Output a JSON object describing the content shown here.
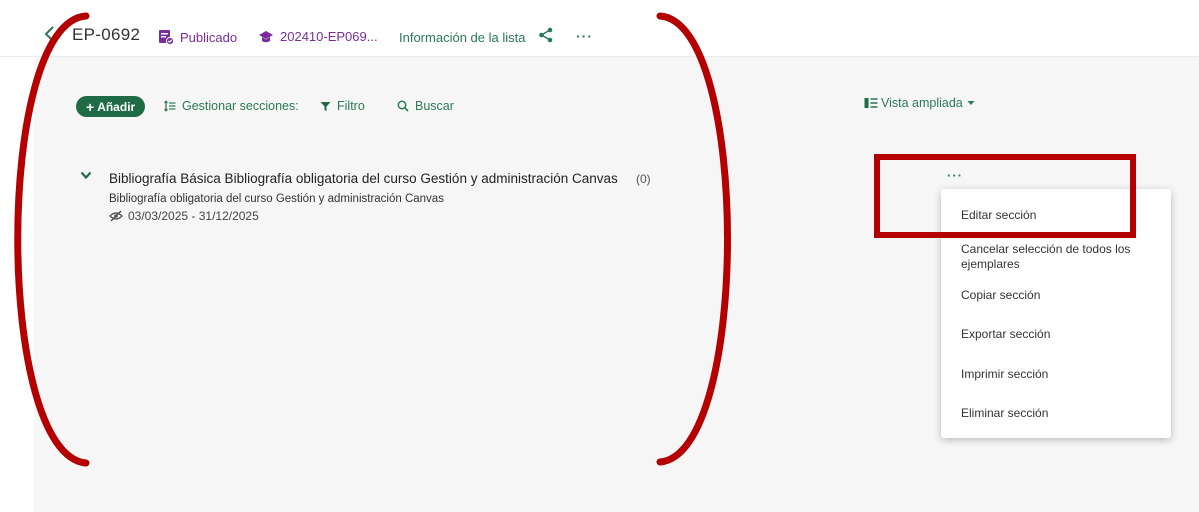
{
  "header": {
    "list_id": "EP-0692",
    "status_label": "Publicado",
    "course_label": "202410-EP069...",
    "info_link": "Información de la lista"
  },
  "toolbar": {
    "add_label": "Añadir",
    "manage_label": "Gestionar secciones:",
    "filter_label": "Filtro",
    "search_label": "Buscar",
    "view_label": "Vista ampliada"
  },
  "section": {
    "title": "Bibliografía Básica Bibliografía obligatoria del curso Gestión y administración Canvas",
    "count": "(0)",
    "description": "Bibliografía obligatoria del curso Gestión y administración Canvas",
    "dates": "03/03/2025 - 31/12/2025"
  },
  "menu": {
    "items": [
      "Editar sección",
      "Cancelar selección de todos los ejemplares",
      "Copiar sección",
      "Exportar sección",
      "Imprimir sección",
      "Eliminar sección"
    ]
  },
  "colors": {
    "accent_green": "#1f6b46",
    "link_green": "#2a7a55",
    "status_purple": "#7b2d9e",
    "annotation_red": "#b40000"
  },
  "icons": [
    "chevron-left-icon",
    "published-icon",
    "graduation-cap-icon",
    "share-icon",
    "more-icon",
    "sort-icon",
    "filter-icon",
    "search-icon",
    "view-icon",
    "caret-down-icon",
    "chevron-down-icon",
    "hidden-eye-icon"
  ]
}
